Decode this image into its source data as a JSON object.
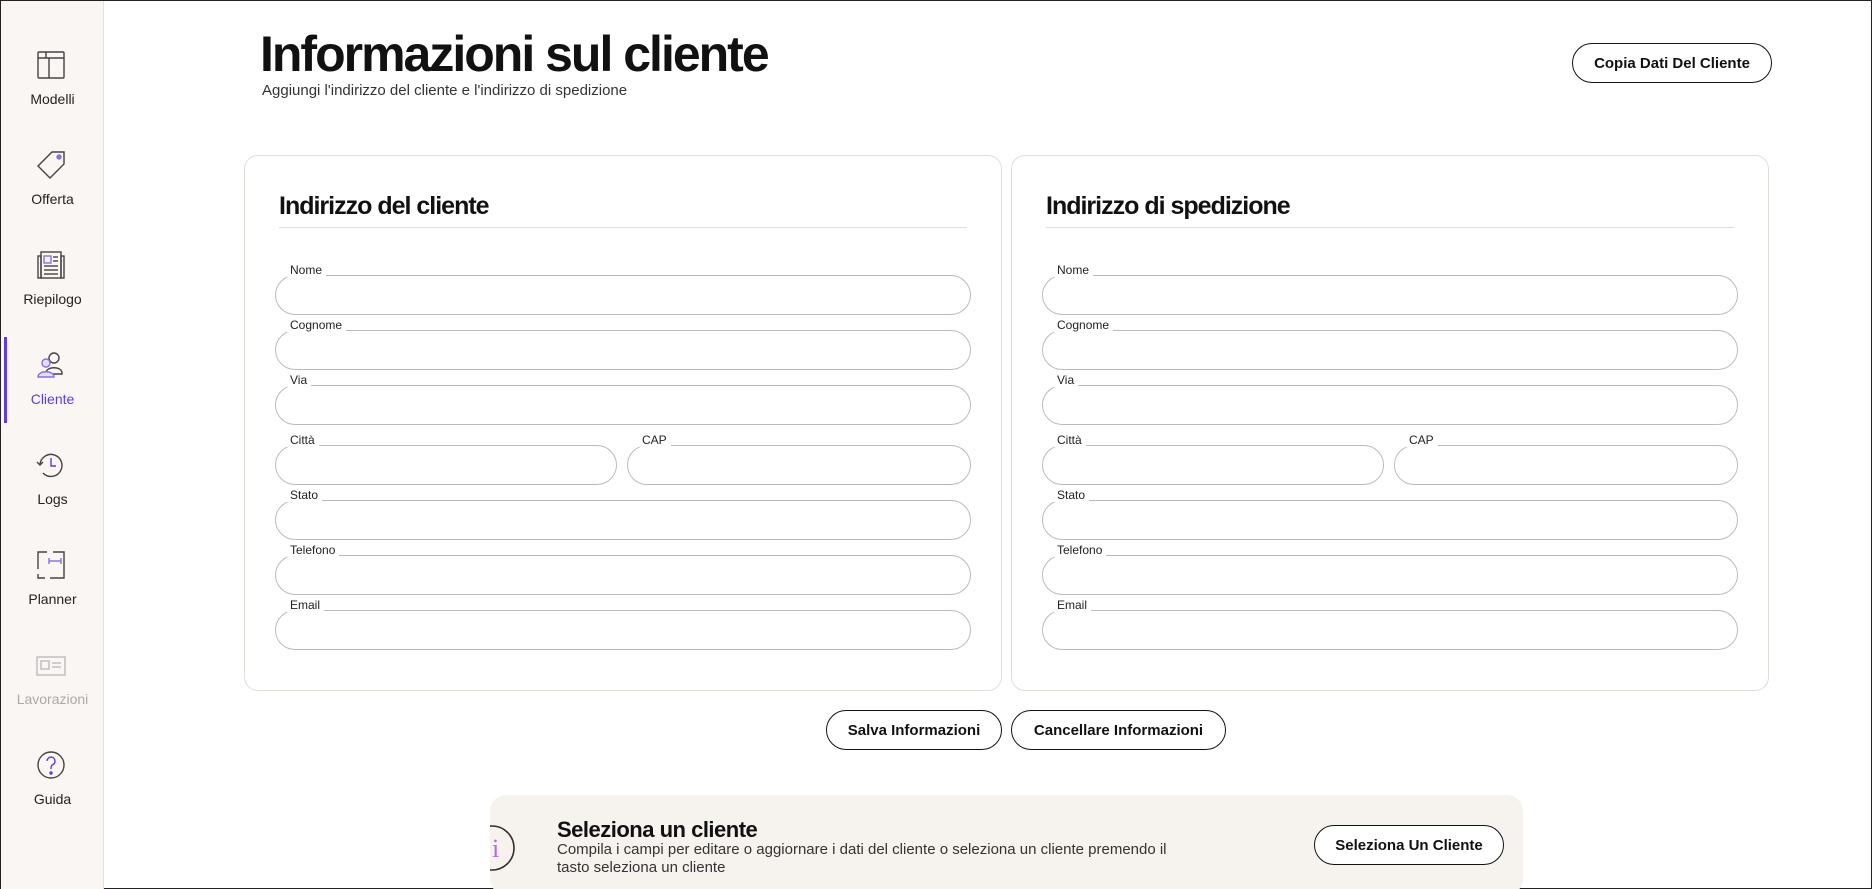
{
  "sidebar": {
    "items": [
      {
        "id": "modelli",
        "label": "Modelli",
        "icon": "layout-template-icon",
        "active": false,
        "disabled": false
      },
      {
        "id": "offerta",
        "label": "Offerta",
        "icon": "price-tag-icon",
        "active": false,
        "disabled": false
      },
      {
        "id": "riepilogo",
        "label": "Riepilogo",
        "icon": "document-summary-icon",
        "active": false,
        "disabled": false
      },
      {
        "id": "cliente",
        "label": "Cliente",
        "icon": "users-icon",
        "active": true,
        "disabled": false
      },
      {
        "id": "logs",
        "label": "Logs",
        "icon": "history-clock-icon",
        "active": false,
        "disabled": false
      },
      {
        "id": "planner",
        "label": "Planner",
        "icon": "floor-plan-icon",
        "active": false,
        "disabled": false
      },
      {
        "id": "lavorazioni",
        "label": "Lavorazioni",
        "icon": "id-card-icon",
        "active": false,
        "disabled": true
      },
      {
        "id": "guida",
        "label": "Guida",
        "icon": "help-circle-icon",
        "active": false,
        "disabled": false
      }
    ],
    "accent_color": "#5b3fd6"
  },
  "header": {
    "title": "Informazioni sul cliente",
    "subtitle": "Aggiungi l'indirizzo del cliente e l'indirizzo di spedizione",
    "copy_button_label": "Copia Dati Del Cliente"
  },
  "customer_address": {
    "title": "Indirizzo del cliente",
    "fields": {
      "nome": {
        "label": "Nome",
        "value": ""
      },
      "cognome": {
        "label": "Cognome",
        "value": ""
      },
      "via": {
        "label": "Via",
        "value": ""
      },
      "citta": {
        "label": "Città",
        "value": ""
      },
      "cap": {
        "label": "CAP",
        "value": ""
      },
      "stato": {
        "label": "Stato",
        "value": ""
      },
      "telefono": {
        "label": "Telefono",
        "value": ""
      },
      "email": {
        "label": "Email",
        "value": ""
      }
    }
  },
  "shipping_address": {
    "title": "Indirizzo di spedizione",
    "fields": {
      "nome": {
        "label": "Nome",
        "value": ""
      },
      "cognome": {
        "label": "Cognome",
        "value": ""
      },
      "via": {
        "label": "Via",
        "value": ""
      },
      "citta": {
        "label": "Città",
        "value": ""
      },
      "cap": {
        "label": "CAP",
        "value": ""
      },
      "stato": {
        "label": "Stato",
        "value": ""
      },
      "telefono": {
        "label": "Telefono",
        "value": ""
      },
      "email": {
        "label": "Email",
        "value": ""
      }
    }
  },
  "actions": {
    "save_label": "Salva Informazioni",
    "clear_label": "Cancellare Informazioni"
  },
  "banner": {
    "icon": "info-icon",
    "icon_glyph": "i",
    "title": "Seleziona un cliente",
    "text": "Compila i campi per editare o aggiornare i dati del cliente o seleziona un cliente premendo il tasto seleziona un cliente",
    "button_label": "Seleziona Un Cliente"
  }
}
